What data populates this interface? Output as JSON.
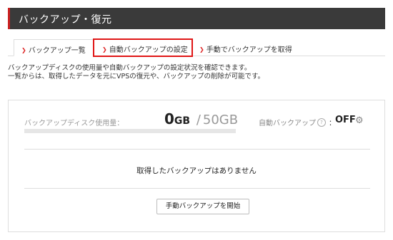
{
  "header": {
    "title": "バックアップ・復元"
  },
  "tabs": [
    {
      "label": "バックアップ一覧"
    },
    {
      "label": "自動バックアップの設定"
    },
    {
      "label": "手動でバックアップを取得"
    }
  ],
  "description": {
    "line1": "バックアップディスクの使用量や自動バックアップの設定状況を確認できます。",
    "line2": "一覧からは、取得したデータを元にVPSの復元や、バックアップの削除が可能です。"
  },
  "usage": {
    "label": "バックアップディスク使用量：",
    "used": "0",
    "used_unit": "GB",
    "separator": "/",
    "total": "50GB",
    "fill_fraction": 0
  },
  "auto_backup": {
    "label": "自動バックアップ",
    "help_icon": "?",
    "colon": "：",
    "value": "OFF",
    "settings_icon": "gear-icon"
  },
  "empty_message": "取得したバックアップはありません",
  "start_button": {
    "label": "手動バックアップを開始"
  },
  "colors": {
    "accent": "#cc2222",
    "header_bg": "#3a3a3a"
  }
}
